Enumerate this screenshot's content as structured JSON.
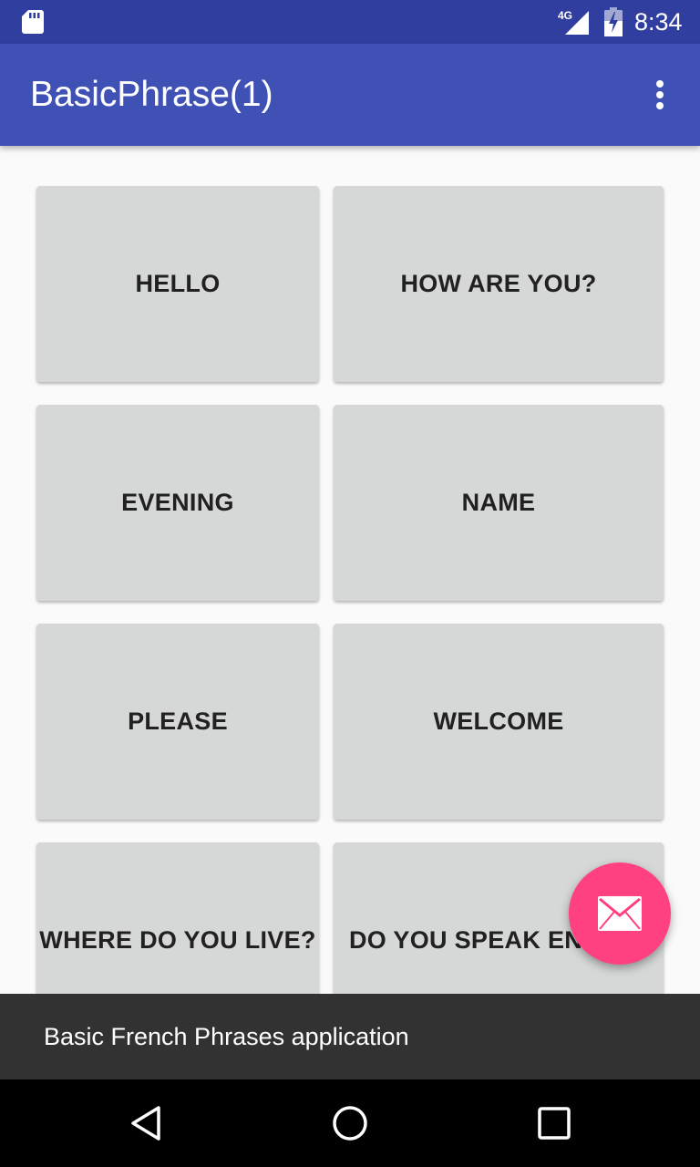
{
  "status_bar": {
    "time": "8:34",
    "network_label": "4G",
    "icons": [
      "sd-card-icon",
      "cell-signal-icon",
      "battery-icon"
    ]
  },
  "app_bar": {
    "title": "BasicPhrase(1)",
    "overflow_icon": "more-vert-icon"
  },
  "phrases": [
    {
      "label": "HELLO"
    },
    {
      "label": "HOW ARE YOU?"
    },
    {
      "label": "EVENING"
    },
    {
      "label": "NAME"
    },
    {
      "label": "PLEASE"
    },
    {
      "label": "WELCOME"
    },
    {
      "label": "WHERE DO YOU LIVE?"
    },
    {
      "label": "DO YOU SPEAK ENGLISH?"
    }
  ],
  "fab": {
    "icon": "email-icon",
    "color": "#ff4081"
  },
  "snackbar": {
    "text": "Basic French Phrases application"
  },
  "nav_bar": {
    "icons": [
      "back-icon",
      "home-icon",
      "recents-icon"
    ]
  },
  "colors": {
    "primary": "#3f51b5",
    "primary_dark": "#303f9f",
    "accent": "#ff4081",
    "button_bg": "#d6d7d7"
  }
}
